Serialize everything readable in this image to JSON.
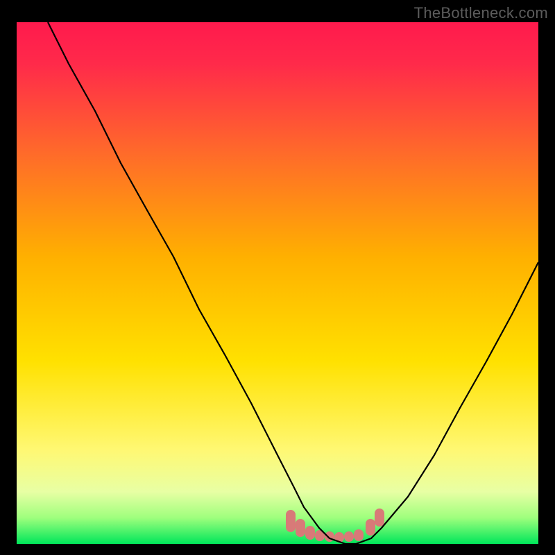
{
  "watermark": "TheBottleneck.com",
  "colors": {
    "page_bg": "#000000",
    "gradient_top": "#ff1a4d",
    "gradient_mid1": "#ff8a00",
    "gradient_mid2": "#ffe100",
    "gradient_low": "#f6ff8a",
    "gradient_bottom": "#00e65a",
    "curve_stroke": "#000000",
    "marker_fill": "#d87a78",
    "watermark_color": "#5c5c5c"
  },
  "chart_data": {
    "type": "line",
    "title": "",
    "xlabel": "",
    "ylabel": "",
    "xlim": [
      0,
      100
    ],
    "ylim": [
      0,
      100
    ],
    "series": [
      {
        "name": "bottleneck-curve",
        "x": [
          6,
          10,
          15,
          20,
          25,
          30,
          35,
          40,
          45,
          50,
          53,
          55,
          58,
          60,
          63,
          65,
          68,
          70,
          75,
          80,
          85,
          90,
          95,
          100
        ],
        "y": [
          100,
          92,
          83,
          73,
          64,
          55,
          45,
          36,
          27,
          17,
          11,
          7,
          3,
          1,
          0,
          0,
          1,
          3,
          9,
          17,
          26,
          35,
          44,
          54
        ]
      }
    ],
    "markers": {
      "name": "bottom-band-markers",
      "x": [
        53,
        55,
        57,
        59,
        61,
        63,
        65,
        67,
        69
      ],
      "y": [
        3,
        2,
        1,
        1,
        1,
        1,
        1,
        2,
        3
      ]
    },
    "gradient_description": "Vertical rainbow gradient from red (top) through orange, yellow, pale-yellow to green (bottom) representing bottleneck severity; curve shows bottleneck percentage vs configuration, dipping to ~0% near x≈63–65."
  }
}
